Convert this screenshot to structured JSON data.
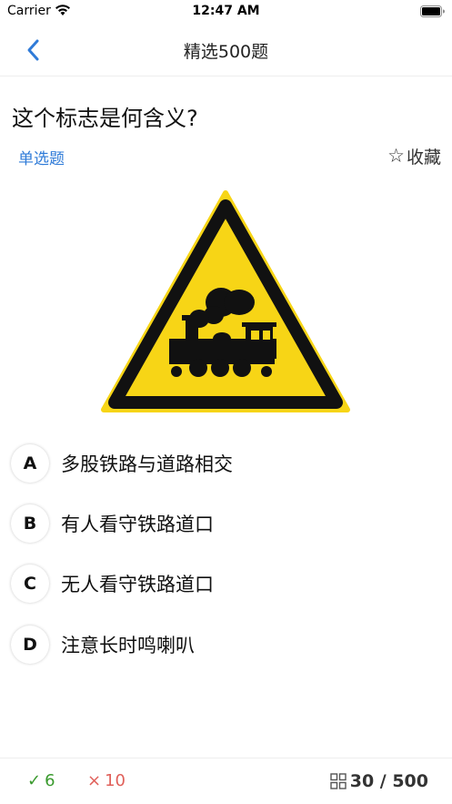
{
  "status_bar": {
    "carrier": "Carrier",
    "time": "12:47 AM"
  },
  "nav": {
    "title": "精选500题"
  },
  "question": {
    "text": "这个标志是何含义?",
    "type": "单选题",
    "favorite_label": "收藏",
    "favorite_icon": "☆"
  },
  "options": [
    {
      "letter": "A",
      "text": "多股铁路与道路相交"
    },
    {
      "letter": "B",
      "text": "有人看守铁路道口"
    },
    {
      "letter": "C",
      "text": "无人看守铁路道口"
    },
    {
      "letter": "D",
      "text": "注意长时鸣喇叭"
    }
  ],
  "footer": {
    "correct_icon": "✓",
    "correct_count": "6",
    "wrong_icon": "×",
    "wrong_count": "10",
    "progress": "30 / 500"
  },
  "colors": {
    "accent": "#2f7bd8",
    "correct": "#3a9a2e",
    "wrong": "#e0605a",
    "sign_yellow": "#f7d516"
  }
}
